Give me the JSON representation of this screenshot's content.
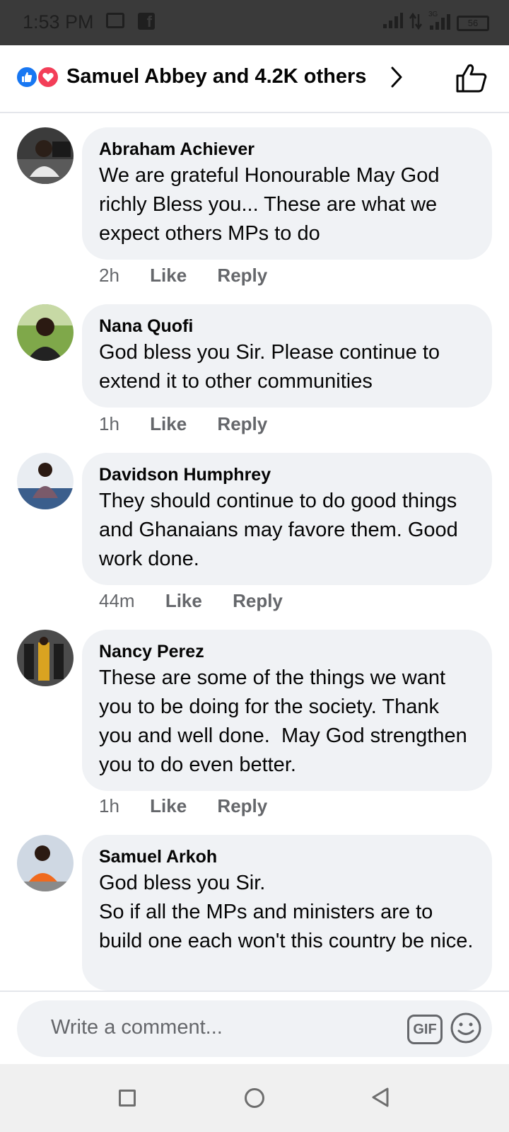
{
  "status_bar": {
    "time": "1:53 PM",
    "network": "3G",
    "battery": "56",
    "icons": [
      "gallery-icon",
      "facebook-icon",
      "signal-icon",
      "data-arrows-icon",
      "signal-3g-icon",
      "battery-icon"
    ]
  },
  "header": {
    "reactions_text": "Samuel Abbey and 4.2K others",
    "reaction_icons": [
      "like-reaction-icon",
      "love-reaction-icon"
    ],
    "colors": {
      "like": "#1877f2",
      "love": "#f33e58"
    }
  },
  "comments": [
    {
      "author": "Abraham Achiever",
      "text": "We are grateful Honourable May God richly Bless you... These are what we expect others MPs to do",
      "time": "2h",
      "like": "Like",
      "reply": "Reply"
    },
    {
      "author": "Nana Quofi",
      "text": "God bless you Sir. Please continue to extend it to other communities",
      "time": "1h",
      "like": "Like",
      "reply": "Reply"
    },
    {
      "author": "Davidson Humphrey",
      "text": "They should continue to do good things and Ghanaians may favore them. Good work done.",
      "time": "44m",
      "like": "Like",
      "reply": "Reply"
    },
    {
      "author": "Nancy Perez",
      "text": "These are some of the things we want you to be doing for the society. Thank you and well done.  May God strengthen you to do even better.",
      "time": "1h",
      "like": "Like",
      "reply": "Reply"
    },
    {
      "author": "Samuel Arkoh",
      "text": "God bless you Sir.\nSo if all the MPs and ministers are to build one each won't this country be nice.",
      "time": "",
      "like": "",
      "reply": ""
    }
  ],
  "composer": {
    "placeholder": "Write a comment...",
    "gif_label": "GIF"
  },
  "colors": {
    "bubble": "#f0f2f5",
    "meta_text": "#65676b",
    "status_bar": "#3a3a3a"
  }
}
